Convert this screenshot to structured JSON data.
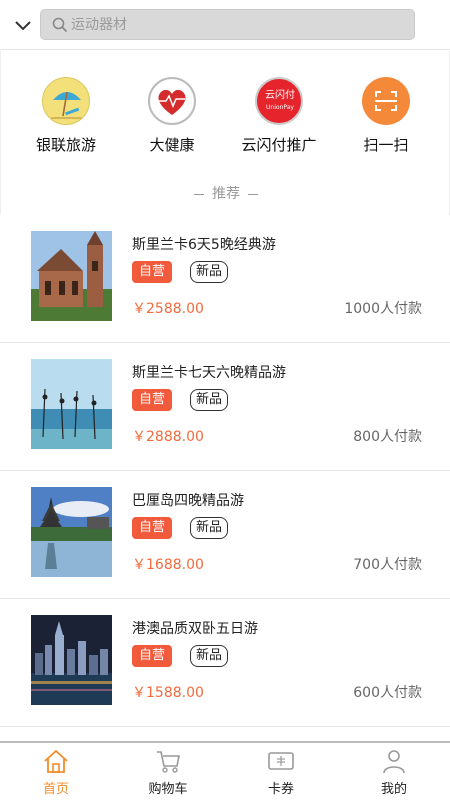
{
  "search": {
    "placeholder": "运动器材"
  },
  "categories": [
    {
      "label": "银联旅游",
      "icon": "beach-umbrella-icon"
    },
    {
      "label": "大健康",
      "icon": "heart-pulse-icon"
    },
    {
      "label": "云闪付推广",
      "icon": "unionpay-quickpass-icon",
      "logo_text": "云闪付",
      "logo_sub": "UnionPay"
    },
    {
      "label": "扫一扫",
      "icon": "scan-icon"
    }
  ],
  "section": {
    "title": "推荐"
  },
  "products": [
    {
      "title": "斯里兰卡6天5晚经典游",
      "tag_self": "自营",
      "tag_new": "新品",
      "price": "￥2588.00",
      "paid": "1000人付款",
      "image": "colonial-church-photo"
    },
    {
      "title": "斯里兰卡七天六晚精品游",
      "tag_self": "自营",
      "tag_new": "新品",
      "price": "￥2888.00",
      "paid": "800人付款",
      "image": "stilt-fishermen-photo"
    },
    {
      "title": "巴厘岛四晚精品游",
      "tag_self": "自营",
      "tag_new": "新品",
      "price": "￥1688.00",
      "paid": "700人付款",
      "image": "bali-temple-photo"
    },
    {
      "title": "港澳品质双卧五日游",
      "tag_self": "自营",
      "tag_new": "新品",
      "price": "￥1588.00",
      "paid": "600人付款",
      "image": "hongkong-night-skyline-photo"
    }
  ],
  "tabs": [
    {
      "label": "首页",
      "icon": "home-icon",
      "active": true
    },
    {
      "label": "购物车",
      "icon": "cart-icon",
      "active": false
    },
    {
      "label": "卡券",
      "icon": "coupon-icon",
      "active": false
    },
    {
      "label": "我的",
      "icon": "user-icon",
      "active": false
    }
  ],
  "colors": {
    "accent": "#f28c2a",
    "price": "#f26b3c",
    "tag_self_bg": "#f15a3b"
  }
}
